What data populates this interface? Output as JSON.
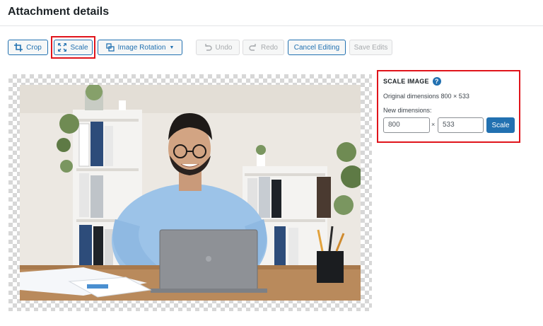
{
  "header": {
    "title": "Attachment details"
  },
  "toolbar": {
    "crop": "Crop",
    "scale": "Scale",
    "rotation": "Image Rotation",
    "undo": "Undo",
    "redo": "Redo",
    "cancel": "Cancel Editing",
    "save": "Save Edits"
  },
  "scale_panel": {
    "heading": "SCALE IMAGE",
    "help": "?",
    "original": "Original dimensions 800 × 533",
    "new_label": "New dimensions:",
    "width_value": "800",
    "height_value": "533",
    "times": "×",
    "button": "Scale"
  },
  "colors": {
    "accent": "#2271b1",
    "highlight": "#e0141b",
    "disabled": "#a7aaad"
  }
}
